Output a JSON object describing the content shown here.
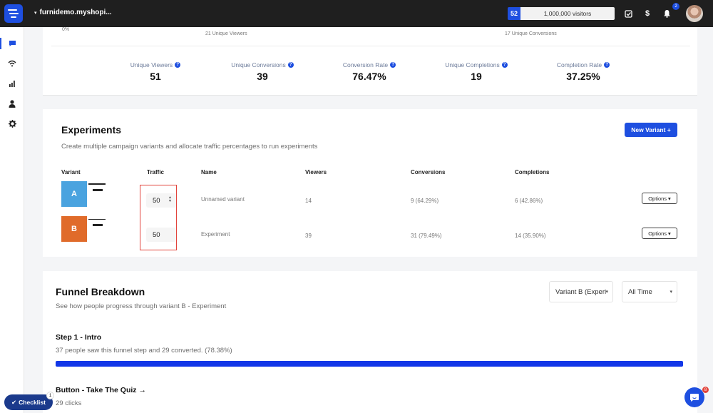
{
  "topbar": {
    "store_name": "furnidemo.myshopi...",
    "visitor_count": "52",
    "visitor_limit": "1,000,000 visitors",
    "notification_count": "2",
    "icons": [
      "task-check-icon",
      "dollar-icon",
      "bell-icon"
    ]
  },
  "sidebar": {
    "items": [
      "chat-icon",
      "wifi-icon",
      "bar-chart-icon",
      "user-icon",
      "gear-icon"
    ],
    "active": "chat-icon"
  },
  "overview": {
    "top_zero": "0%",
    "top_viewers": "21 Unique Viewers",
    "top_conversions": "17 Unique Conversions",
    "stats": [
      {
        "label": "Unique Viewers",
        "value": "51"
      },
      {
        "label": "Unique Conversions",
        "value": "39"
      },
      {
        "label": "Conversion Rate",
        "value": "76.47%"
      },
      {
        "label": "Unique Completions",
        "value": "19"
      },
      {
        "label": "Completion Rate",
        "value": "37.25%"
      }
    ]
  },
  "experiments": {
    "title": "Experiments",
    "subtitle": "Create multiple campaign variants and allocate traffic percentages to run experiments",
    "new_variant_label": "New Variant +",
    "columns": [
      "Variant",
      "Traffic",
      "Name",
      "Viewers",
      "Conversions",
      "Completions"
    ],
    "rows": [
      {
        "letter": "A",
        "color": "#4aa3df",
        "traffic": "50",
        "name": "Unnamed variant",
        "viewers": "14",
        "conversions": "9 (64.29%)",
        "completions": "6 (42.86%)",
        "options_label": "Options"
      },
      {
        "letter": "B",
        "color": "#e06b2a",
        "traffic": "50",
        "name": "Experiment",
        "viewers": "39",
        "conversions": "31 (79.49%)",
        "completions": "14 (35.90%)",
        "options_label": "Options"
      }
    ]
  },
  "funnel": {
    "title": "Funnel Breakdown",
    "subtitle": "See how people progress through variant B - Experiment",
    "variant_select": "Variant B (Experi",
    "time_select": "All Time",
    "step1_title": "Step 1 - Intro",
    "step1_desc": "37 people saw this funnel step and 29 converted. (78.38%)",
    "step1_progress": 1.0,
    "step2_title": "Button - Take The Quiz →",
    "step2_desc": "29 clicks"
  },
  "footer": {
    "checklist_label": "Checklist",
    "checklist_badge": "1",
    "chat_badge": "8"
  },
  "colors": {
    "brand": "#1e4fe0",
    "highlight": "#e2433b"
  }
}
